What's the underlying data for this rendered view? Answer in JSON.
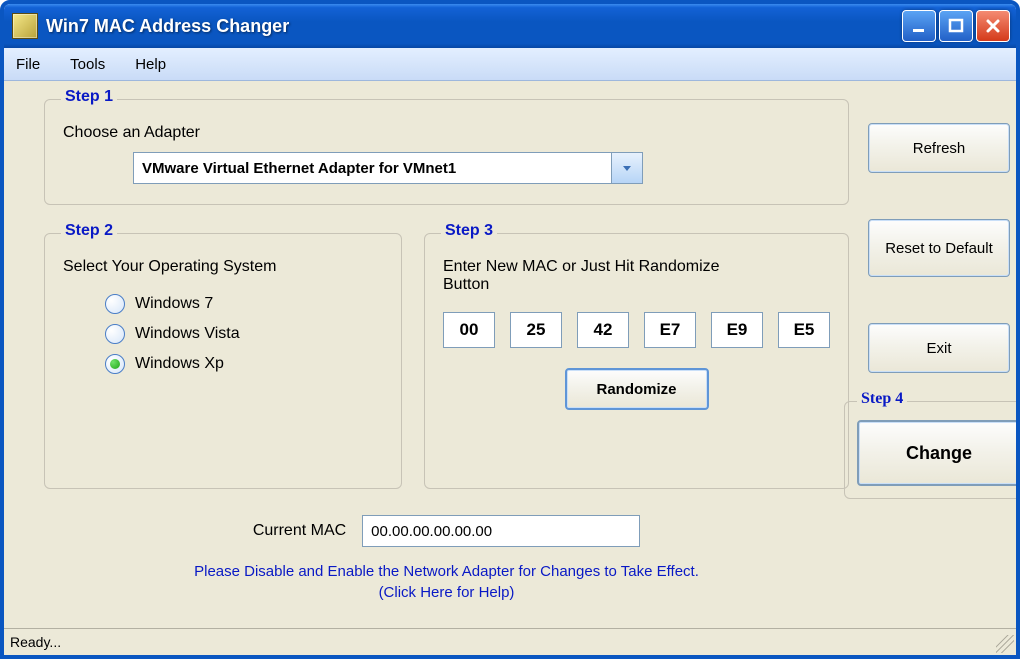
{
  "title": "Win7 MAC Address Changer",
  "menu": {
    "file": "File",
    "tools": "Tools",
    "help": "Help"
  },
  "step1": {
    "title": "Step 1",
    "label": "Choose an Adapter",
    "adapter": "VMware Virtual Ethernet Adapter for VMnet1"
  },
  "step2": {
    "title": "Step 2",
    "label": "Select Your Operating System",
    "options": {
      "win7": "Windows 7",
      "vista": "Windows Vista",
      "xp": "Windows Xp"
    }
  },
  "step3": {
    "title": "Step 3",
    "label": "Enter New MAC or Just Hit Randomize Button",
    "mac": [
      "00",
      "25",
      "42",
      "E7",
      "E9",
      "E5"
    ],
    "randomize": "Randomize"
  },
  "buttons": {
    "refresh": "Refresh",
    "reset": "Reset to Default",
    "exit": "Exit",
    "change": "Change"
  },
  "step4": {
    "title": "Step 4"
  },
  "current": {
    "label": "Current MAC",
    "value": "00.00.00.00.00.00"
  },
  "hint_line1": "Please Disable and Enable the Network Adapter for Changes to Take Effect.",
  "hint_line2": "(Click Here for Help)",
  "status": "Ready..."
}
